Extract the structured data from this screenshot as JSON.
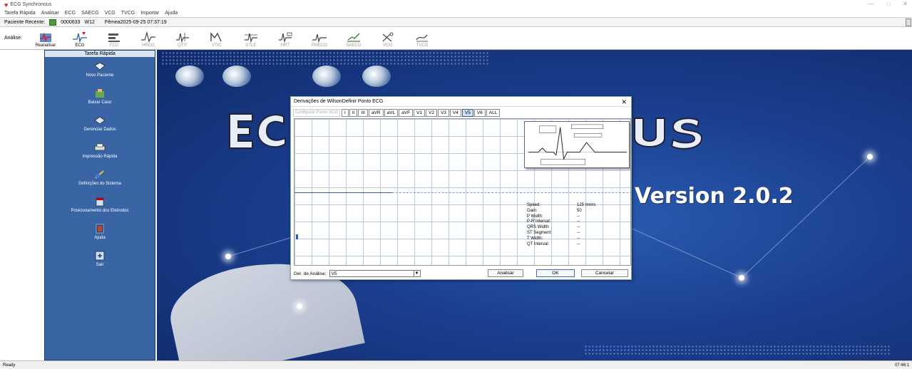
{
  "app": {
    "title": "ECG Synchronous",
    "window_controls": [
      "—",
      "□",
      "✕"
    ]
  },
  "menu": [
    "Tarefa Rápida",
    "Analisar",
    "ECG",
    "SAECG",
    "VCG",
    "TVCG",
    "Importar",
    "Ajuda"
  ],
  "patient": {
    "label": "Paciente Recente:",
    "id": "0000633",
    "code": "W12",
    "sex_date": "Fêmea2025-09-25 07:37:19"
  },
  "toolbar": {
    "label": "Análise:",
    "tools": [
      {
        "label": "Reanalisar"
      },
      {
        "label": "ECG"
      },
      {
        "label": "FCD"
      },
      {
        "label": "HRCG"
      },
      {
        "label": "QTIT"
      },
      {
        "label": "VTIC"
      },
      {
        "label": "STLE"
      },
      {
        "label": "HRT"
      },
      {
        "label": "PMECG"
      },
      {
        "label": "SAECG"
      },
      {
        "label": "VCG"
      },
      {
        "label": "TVCG"
      }
    ]
  },
  "sidebar": {
    "header": "Tarefa Rápida",
    "items": [
      {
        "label": "Novo Paciente"
      },
      {
        "label": "Baixar Caso"
      },
      {
        "label": "Gerenciar Dados"
      },
      {
        "label": "Impressão Rápida"
      },
      {
        "label": "Definições do Sistema"
      },
      {
        "label": "Posicionamento dos Eletrodos"
      },
      {
        "label": "Ajuda"
      },
      {
        "label": "Sair"
      }
    ]
  },
  "desktop": {
    "version": "Version 2.0.2"
  },
  "dialog": {
    "title": "Derivações de WilsonDefinir Ponto ECG",
    "config_button": "Configurar Ponto VCG",
    "leads": [
      "I",
      "II",
      "III",
      "aVR",
      "aVL",
      "aVF",
      "V1",
      "V2",
      "V3",
      "V4",
      "V5",
      "V6",
      "ALL"
    ],
    "selected_lead": "V5",
    "measurements": [
      {
        "key": "Speed:",
        "value": "125 mm/s"
      },
      {
        "key": "Gain:",
        "value": "50"
      },
      {
        "key": "P Width:",
        "value": "--"
      },
      {
        "key": "P-R Interval:",
        "value": "--"
      },
      {
        "key": "QRS Width:",
        "value": "--"
      },
      {
        "key": "ST Segment:",
        "value": "--"
      },
      {
        "key": "T Width:",
        "value": "--"
      },
      {
        "key": "QT Interval:",
        "value": "--"
      }
    ],
    "analysis_label": "Der. de Análise:",
    "analysis_value": "V5",
    "buttons": {
      "analyze": "Analisar",
      "ok": "OK",
      "cancel": "Cancelar"
    }
  },
  "status": {
    "text": "Ready",
    "clock": "07:46:1"
  }
}
